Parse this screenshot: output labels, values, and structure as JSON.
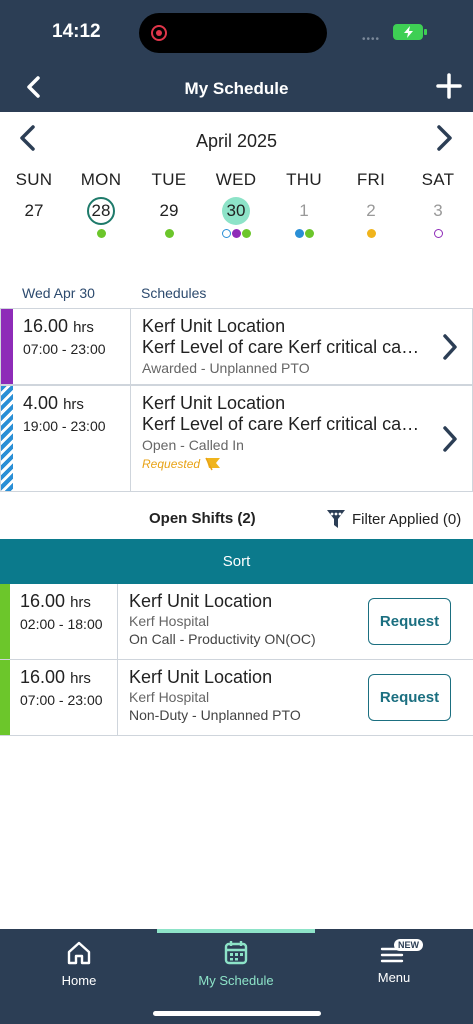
{
  "status": {
    "time": "14:12",
    "signal": "••••"
  },
  "nav": {
    "title": "My Schedule",
    "back_icon": "chevron-left-icon",
    "add_icon": "plus-icon"
  },
  "calendar": {
    "month": "April 2025",
    "days": [
      {
        "name": "SUN",
        "num": "27"
      },
      {
        "name": "MON",
        "num": "28"
      },
      {
        "name": "TUE",
        "num": "29"
      },
      {
        "name": "WED",
        "num": "30"
      },
      {
        "name": "THU",
        "num": "1"
      },
      {
        "name": "FRI",
        "num": "2"
      },
      {
        "name": "SAT",
        "num": "3"
      }
    ],
    "colors": {
      "green": "#6cc62b",
      "purple": "#8e2bb8",
      "blue": "#2a8fd6",
      "yellow": "#f0b41c",
      "selected": "#8de3c8",
      "today_ring": "#1e7a6a"
    }
  },
  "schedules": {
    "date_label": "Wed Apr 30",
    "column_label": "Schedules",
    "items": [
      {
        "hours": "16.00",
        "unit": "hrs",
        "time": "07:00 - 23:00",
        "location": "Kerf Unit Location",
        "detail": "Kerf Level of care Kerf critical care unit",
        "status": "Awarded - Unplanned PTO",
        "color": "#8e2bb8"
      },
      {
        "hours": "4.00",
        "unit": "hrs",
        "time": "19:00 - 23:00",
        "location": "Kerf Unit Location",
        "detail": "Kerf Level of care Kerf critical care unit",
        "status": "Open - Called In",
        "tag": "Requested",
        "color": "#2a8fd6"
      }
    ]
  },
  "open_shifts": {
    "title": "Open Shifts (2)",
    "filter_label": "Filter Applied (0)",
    "sort_label": "Sort",
    "items": [
      {
        "hours": "16.00",
        "unit": "hrs",
        "time": "02:00 - 18:00",
        "location": "Kerf Unit Location",
        "facility": "Kerf Hospital",
        "type": "On Call - Productivity ON(OC)",
        "button": "Request"
      },
      {
        "hours": "16.00",
        "unit": "hrs",
        "time": "07:00 - 23:00",
        "location": "Kerf Unit Location",
        "facility": "Kerf Hospital",
        "type": "Non-Duty - Unplanned PTO",
        "button": "Request"
      }
    ]
  },
  "tabs": {
    "home": "Home",
    "schedule": "My Schedule",
    "menu": "Menu",
    "menu_badge": "NEW"
  },
  "theme": {
    "navy": "#2c3e55",
    "teal": "#0b7a8c",
    "mint": "#8de3c8"
  }
}
